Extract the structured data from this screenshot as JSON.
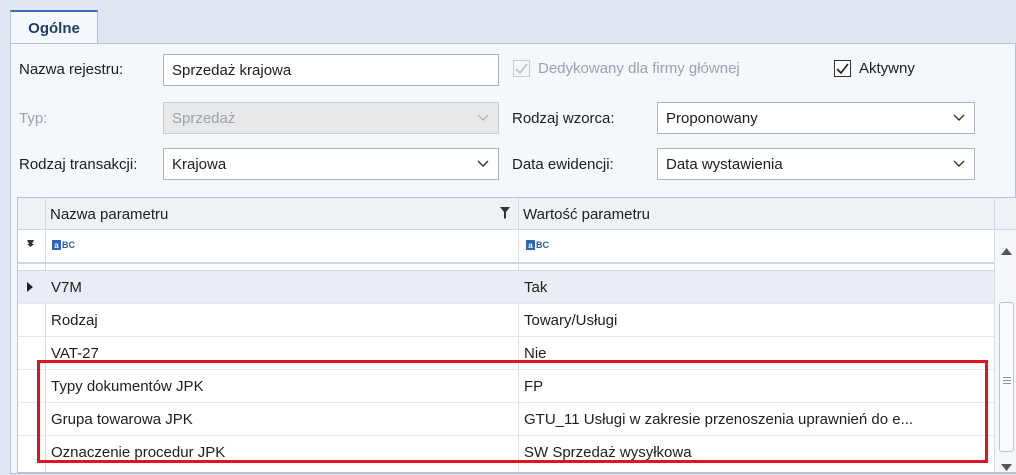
{
  "tabs": [
    {
      "label": "Ogólne",
      "active": true
    }
  ],
  "form": {
    "nazwa_rejestru": {
      "label": "Nazwa rejestru:",
      "value": "Sprzedaż krajowa"
    },
    "dedykowany": {
      "label": "Dedykowany dla firmy głównej",
      "checked": true,
      "disabled": true
    },
    "aktywny": {
      "label": "Aktywny",
      "checked": true
    },
    "typ": {
      "label": "Typ:",
      "value": "Sprzedaż",
      "disabled": true
    },
    "rodzaj_wzorca": {
      "label": "Rodzaj wzorca:",
      "value": "Proponowany"
    },
    "rodzaj_transakcji": {
      "label": "Rodzaj transakcji:",
      "value": "Krajowa"
    },
    "data_ewidencji": {
      "label": "Data ewidencji:",
      "value": "Data wystawienia"
    }
  },
  "grid": {
    "columns": [
      "Nazwa parametru",
      "Wartość parametru"
    ],
    "filter_placeholder": "BC",
    "rows": [
      {
        "name": "V7M",
        "value": "Tak",
        "selected": true
      },
      {
        "name": "Rodzaj",
        "value": "Towary/Usługi"
      },
      {
        "name": "VAT-27",
        "value": "Nie"
      },
      {
        "name": "Typy dokumentów JPK",
        "value": "FP"
      },
      {
        "name": "Grupa towarowa JPK",
        "value": "GTU_11 Usługi w zakresie przenoszenia uprawnień do e..."
      },
      {
        "name": "Oznaczenie procedur JPK",
        "value": "SW Sprzedaż wysyłkowa"
      }
    ]
  },
  "colors": {
    "highlight": "#e0141e",
    "accent": "#3a6fb0"
  },
  "icons": [
    "check-icon",
    "chevron-down-icon",
    "filter-icon",
    "pin-icon",
    "text-filter-icon",
    "row-pointer-icon",
    "scroll-up-icon",
    "scroll-down-icon",
    "scroll-grip-icon"
  ]
}
